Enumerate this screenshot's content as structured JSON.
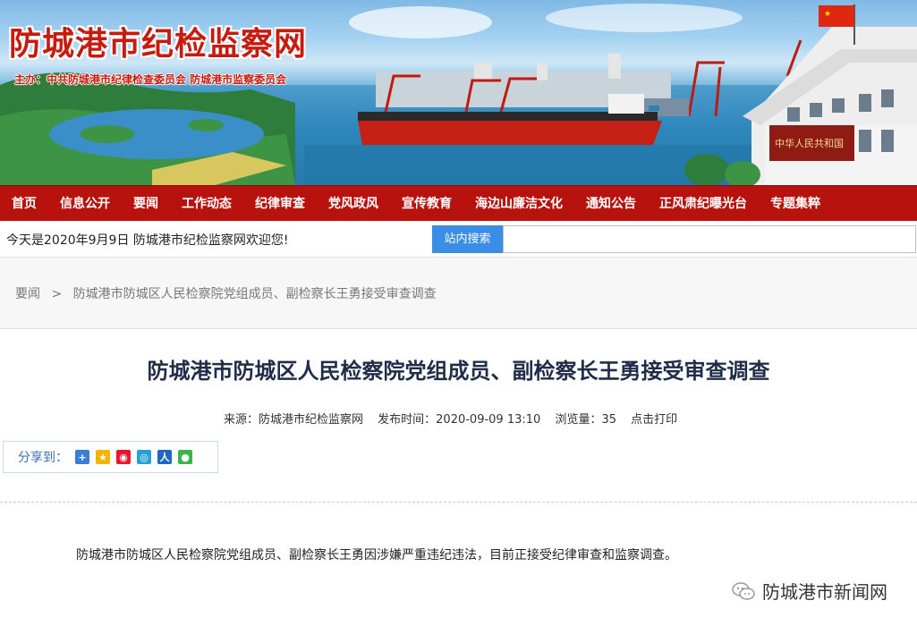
{
  "header": {
    "site_title": "防城港市纪检监察网",
    "sponsor": "主办：中共防城港市纪律检查委员会  防城港市监察委员会",
    "building_sign": "中华人民共和国"
  },
  "nav": {
    "items": [
      "首页",
      "信息公开",
      "要闻",
      "工作动态",
      "纪律审查",
      "党风政风",
      "宣传教育",
      "海边山廉洁文化",
      "通知公告",
      "正风肃纪曝光台",
      "专题集粹"
    ]
  },
  "topbar": {
    "welcome": "今天是2020年9月9日 防城港市纪检监察网欢迎您!",
    "search_button": "站内搜索",
    "search_value": ""
  },
  "breadcrumb": {
    "parent": "要闻",
    "separator": ">",
    "current": "防城港市防城区人民检察院党组成员、副检察长王勇接受审查调查"
  },
  "article": {
    "title": "防城港市防城区人民检察院党组成员、副检察长王勇接受审查调查",
    "source": "来源：防城港市纪检监察网",
    "published": "发布时间：2020-09-09 13:10",
    "views": "浏览量：35",
    "print": "点击打印",
    "share_label": "分享到：",
    "share_icons": [
      "share-more-icon",
      "qzone-icon",
      "weibo-icon",
      "tencent-weibo-icon",
      "renren-icon",
      "wechat-icon"
    ],
    "body": "防城港市防城区人民检察院党组成员、副检察长王勇因涉嫌严重违纪违法，目前正接受纪律审查和监察调查。",
    "watermark": "防城港市新闻网"
  },
  "colors": {
    "nav_bg": "#b7120e",
    "title_red": "#c81b10",
    "search_blue": "#3a8ee6",
    "article_title": "#1f2d49"
  }
}
